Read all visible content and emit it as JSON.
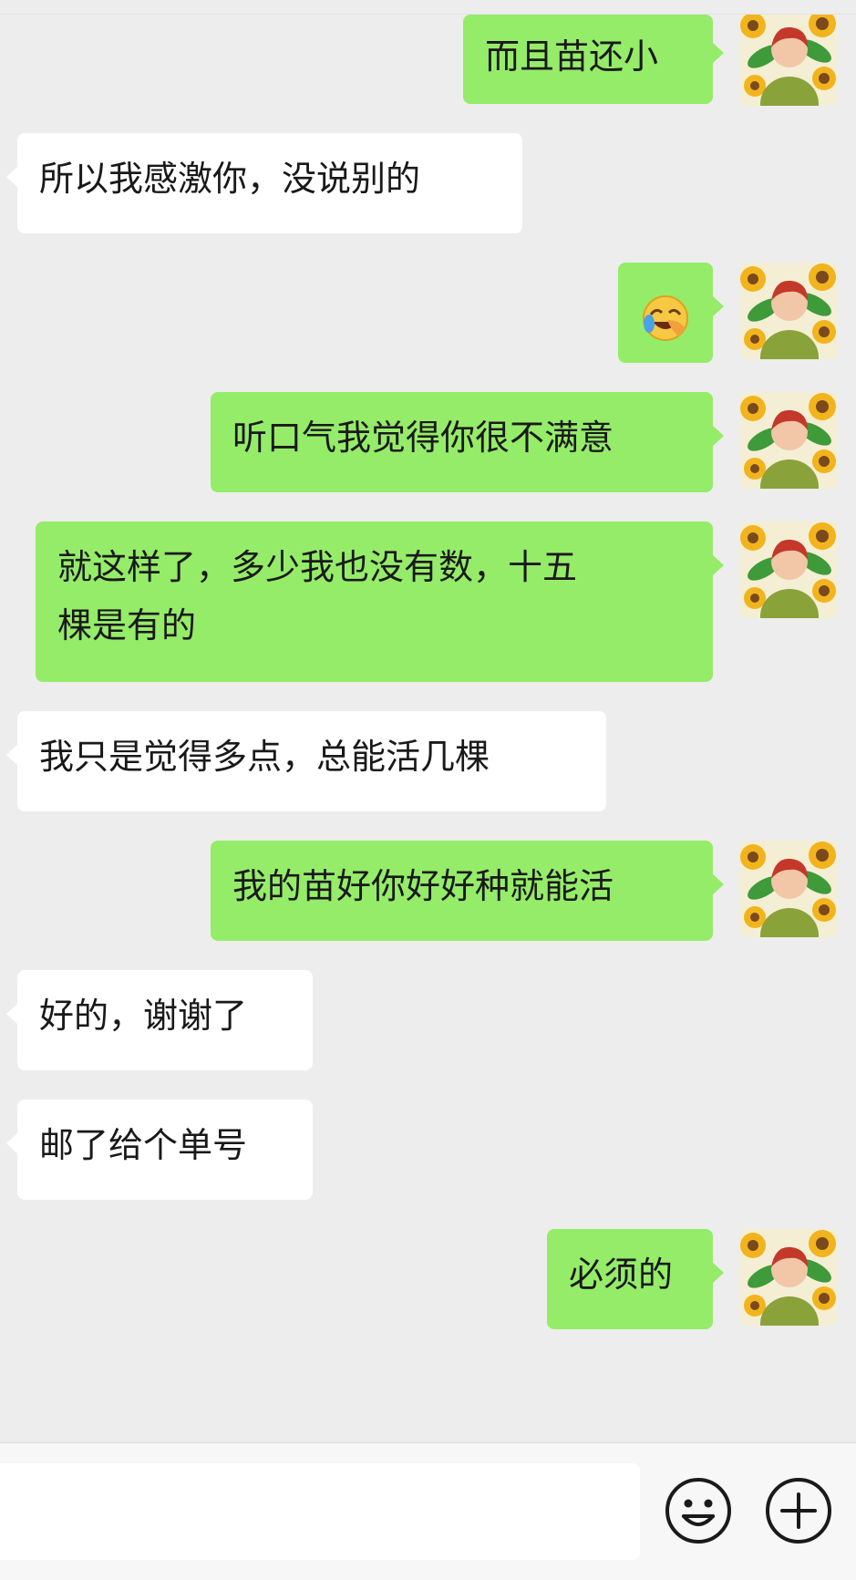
{
  "messages": [
    {
      "side": "me",
      "text": "而且苗还小"
    },
    {
      "side": "them",
      "text": "所以我感激你，没说别的"
    },
    {
      "side": "me",
      "text": "",
      "emoji": "face-with-tears-of-joy-icon"
    },
    {
      "side": "me",
      "text": "听口气我觉得你很不满意"
    },
    {
      "side": "me",
      "text": "就这样了，多少我也没有数，十五\n棵是有的"
    },
    {
      "side": "them",
      "text": "我只是觉得多点，总能活几棵"
    },
    {
      "side": "me",
      "text": "我的苗好你好好种就能活"
    },
    {
      "side": "them",
      "text": "好的，谢谢了"
    },
    {
      "side": "them",
      "text": "邮了给个单号"
    },
    {
      "side": "me",
      "text": "必须的"
    }
  ],
  "input": {
    "value": "",
    "emoji_button_icon": "smiley-face-icon",
    "more_button_icon": "plus-circle-icon"
  },
  "colors": {
    "background": "#ededed",
    "my_bubble": "#95ec69",
    "their_bubble": "#ffffff",
    "text": "#191919"
  }
}
